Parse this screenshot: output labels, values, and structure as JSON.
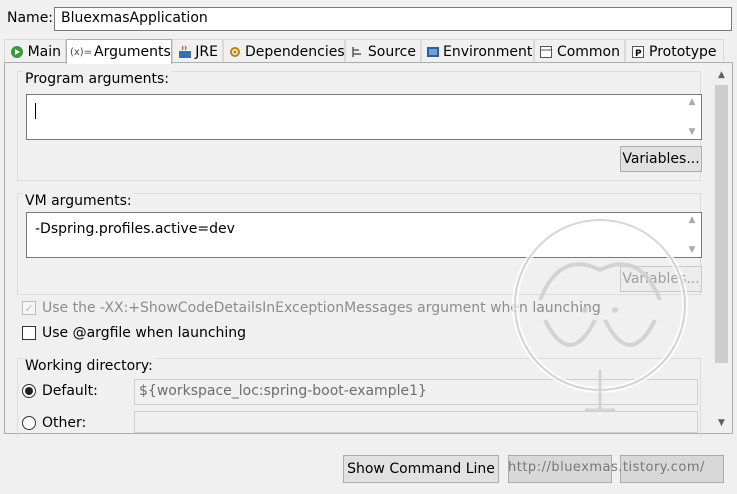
{
  "name_row": {
    "label": "Name:",
    "value": "BluexmasApplication"
  },
  "tabs": [
    {
      "label": "Main",
      "icon": "main-icon"
    },
    {
      "label": "Arguments",
      "icon": "arguments-icon",
      "prefix": "(x)="
    },
    {
      "label": "JRE",
      "icon": "jre-icon"
    },
    {
      "label": "Dependencies",
      "icon": "dependencies-icon"
    },
    {
      "label": "Source",
      "icon": "source-icon"
    },
    {
      "label": "Environment",
      "icon": "environment-icon"
    },
    {
      "label": "Common",
      "icon": "common-icon"
    },
    {
      "label": "Prototype",
      "icon": "prototype-icon"
    }
  ],
  "program_args": {
    "label": "Program arguments:",
    "value": "",
    "variables_label": "Variables..."
  },
  "vm_args": {
    "label": "VM arguments:",
    "value": "-Dspring.profiles.active=dev",
    "variables_label": "Variables..."
  },
  "options": {
    "show_code_details": "Use the -XX:+ShowCodeDetailsInExceptionMessages argument when launching",
    "argfile": "Use @argfile when launching"
  },
  "working_dir": {
    "label": "Working directory:",
    "default_label": "Default:",
    "default_value": "${workspace_loc:spring-boot-example1}",
    "other_label": "Other:"
  },
  "bottom": {
    "show_command_line": "Show Command Line",
    "watermark": "http://bluexmas.tistory.com/"
  }
}
